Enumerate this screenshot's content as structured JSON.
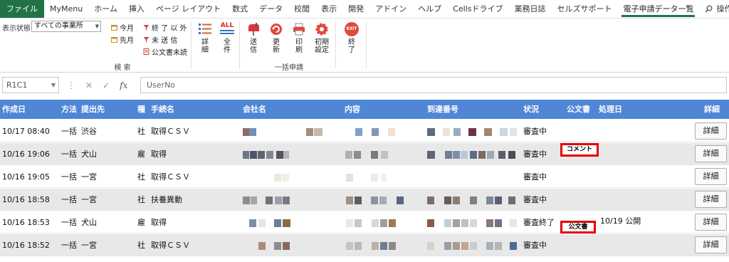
{
  "tabs": [
    {
      "label": "ファイル"
    },
    {
      "label": "MyMenu"
    },
    {
      "label": "ホーム"
    },
    {
      "label": "挿入"
    },
    {
      "label": "ページ レイアウト"
    },
    {
      "label": "数式"
    },
    {
      "label": "データ"
    },
    {
      "label": "校閲"
    },
    {
      "label": "表示"
    },
    {
      "label": "開発"
    },
    {
      "label": "アドイン"
    },
    {
      "label": "ヘルプ"
    },
    {
      "label": "Cellsドライブ"
    },
    {
      "label": "業務日誌"
    },
    {
      "label": "セルズサポート"
    },
    {
      "label": "電子申請データ一覧"
    }
  ],
  "tellme": "操作アシスト",
  "ribbon": {
    "status_label": "表示状態",
    "status_value": "すべての事業所",
    "this_month": "今月",
    "prev_month": "先月",
    "not_done": "終 了 以 外",
    "unsent": "未 送 信",
    "doc_unread": "公文書未読",
    "group_search": "検 索",
    "detail": [
      "詳",
      "細"
    ],
    "all": [
      "全",
      "件"
    ],
    "send": [
      "送",
      "信"
    ],
    "refresh": [
      "更",
      "新"
    ],
    "print": [
      "印",
      "刷"
    ],
    "init": [
      "初期",
      "設定"
    ],
    "exit": [
      "終",
      "了"
    ],
    "exit_icon_text": "EXIT",
    "all_icon_text": "ALL",
    "group_batch": "一括申請"
  },
  "formula": {
    "namebox": "R1C1",
    "fx": "fx",
    "value": "UserNo"
  },
  "table": {
    "headers": {
      "date": "作成日",
      "method": "方法",
      "dest": "提出先",
      "kind": "種",
      "proc": "手続名",
      "company": "会社名",
      "content": "内容",
      "arrival": "到達番号",
      "status": "状況",
      "doc": "公文書",
      "processed": "処理日",
      "detail": "詳細"
    },
    "rows": [
      {
        "date": "10/17 08:40",
        "method": "一括",
        "dest": "渋谷",
        "kind": "社",
        "proc": "取得ＣＳＶ",
        "status": "審査中",
        "doc": "",
        "processed": "",
        "detail": "詳細"
      },
      {
        "date": "10/16 19:06",
        "method": "一括",
        "dest": "犬山",
        "kind": "雇",
        "proc": "取得",
        "status": "審査中",
        "doc": "コメント",
        "processed": "",
        "detail": "詳細"
      },
      {
        "date": "10/16 19:05",
        "method": "一括",
        "dest": "一宮",
        "kind": "社",
        "proc": "取得ＣＳＶ",
        "status": "審査中",
        "doc": "",
        "processed": "",
        "detail": "詳細"
      },
      {
        "date": "10/16 18:58",
        "method": "一括",
        "dest": "一宮",
        "kind": "社",
        "proc": "扶養異動",
        "status": "審査中",
        "doc": "",
        "processed": "",
        "detail": "詳細"
      },
      {
        "date": "10/16 18:53",
        "method": "一括",
        "dest": "犬山",
        "kind": "雇",
        "proc": "取得",
        "status": "審査終了",
        "doc": "公文書",
        "processed": "10/19 公開",
        "detail": "詳細"
      },
      {
        "date": "10/16 18:52",
        "method": "一括",
        "dest": "一宮",
        "kind": "社",
        "proc": "取得ＣＳＶ",
        "status": "審査中",
        "doc": "",
        "processed": "",
        "detail": "詳細"
      }
    ]
  },
  "colors": {
    "file_tab": "#217346",
    "header_bg": "#4f86d6",
    "highlight_red": "#e30000",
    "alt_row": "#e8e8e8"
  },
  "icons": {
    "this_month": "calendar-icon",
    "prev_month": "calendar-icon",
    "not_done": "filter-icon",
    "unsent": "filter-icon",
    "doc_unread": "document-icon",
    "detail": "list-icon",
    "all": "all-icon",
    "send": "mailbox-icon",
    "refresh": "refresh-icon",
    "print": "printer-icon",
    "init": "gear-icon",
    "exit": "exit-icon",
    "tellme": "search-icon"
  }
}
